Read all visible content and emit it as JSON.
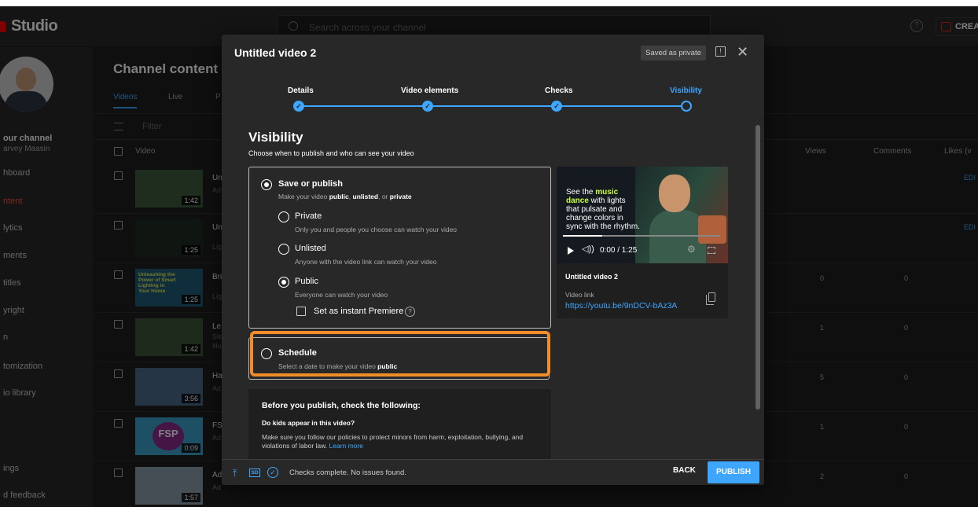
{
  "app": {
    "logo": "Studio"
  },
  "header": {
    "search_placeholder": "Search across your channel",
    "create_label": "CREAT"
  },
  "sidebar": {
    "channel_label": "our channel",
    "channel_name": "arvey Maasin",
    "items": [
      {
        "label": "hboard"
      },
      {
        "label": "ntent"
      },
      {
        "label": "lytics"
      },
      {
        "label": "ments"
      },
      {
        "label": "titles"
      },
      {
        "label": "yright"
      },
      {
        "label": "n"
      },
      {
        "label": "tomization"
      },
      {
        "label": "io library"
      },
      {
        "label": "ings"
      },
      {
        "label": "d feedback"
      }
    ]
  },
  "main": {
    "title": "Channel content",
    "tabs": [
      "Videos",
      "Live",
      "P"
    ],
    "filter": "Filter",
    "columns": {
      "video": "Video",
      "views": "Views",
      "comments": "Comments",
      "likes": "Likes (v"
    },
    "rows": [
      {
        "t": "Un",
        "s": "Ad",
        "dur": "1:42",
        "views": "",
        "comments": "",
        "edit": "EDI"
      },
      {
        "t": "Un",
        "s": "Lig",
        "dur": "1:25",
        "views": "",
        "comments": "",
        "edit": "EDI"
      },
      {
        "t": "Bri",
        "s": "Lig",
        "dur": "1:25",
        "views": "0",
        "comments": "0",
        "edit": "",
        "thumb_text": "Unleashing the Power of Smart Lighting in Your Home"
      },
      {
        "t": "Le",
        "s": "Ste",
        "s2": "Illu",
        "dur": "1:42",
        "views": "1",
        "comments": "0",
        "edit": ""
      },
      {
        "t": "Ha",
        "s": "Ad",
        "dur": "3:56",
        "views": "5",
        "comments": "0",
        "edit": ""
      },
      {
        "t": "FS",
        "s": "Ad",
        "dur": "0:09",
        "views": "1",
        "comments": "0",
        "edit": "",
        "thumb_text": "FSP"
      },
      {
        "t": "Ad",
        "s": "Ad",
        "dur": "1:57",
        "views": "2",
        "comments": "0",
        "edit": ""
      }
    ]
  },
  "dialog": {
    "title": "Untitled video 2",
    "saved_badge": "Saved as private",
    "steps": [
      {
        "label": "Details",
        "state": "done"
      },
      {
        "label": "Video elements",
        "state": "done"
      },
      {
        "label": "Checks",
        "state": "done"
      },
      {
        "label": "Visibility",
        "state": "current"
      }
    ],
    "visibility": {
      "heading": "Visibility",
      "subheading": "Choose when to publish and who can see your video",
      "save_title": "Save or publish",
      "save_desc_pre": "Make your video ",
      "save_desc_public": "public",
      "save_desc_sep1": ", ",
      "save_desc_unlisted": "unlisted",
      "save_desc_sep2": ", or ",
      "save_desc_private": "private",
      "private_label": "Private",
      "private_desc": "Only you and people you choose can watch your video",
      "unlisted_label": "Unlisted",
      "unlisted_desc": "Anyone with the video link can watch your video",
      "public_label": "Public",
      "public_desc": "Everyone can watch your video",
      "premiere_label": "Set as instant Premiere",
      "help_glyph": "?",
      "schedule_label": "Schedule",
      "schedule_desc_pre": "Select a date to make your video ",
      "schedule_desc_public": "public"
    },
    "before": {
      "heading": "Before you publish, check the following:",
      "question": "Do kids appear in this video?",
      "text": "Make sure you follow our policies to protect minors from harm, exploitation, bullying, and violations of labor law. ",
      "link": "Learn more"
    },
    "preview": {
      "overlay_1": "See the ",
      "overlay_music": "music",
      "overlay_dance": "dance",
      "overlay_2": " with lights that pulsate and change colors in sync with the rhythm.",
      "time": "0:00 / 1:25",
      "title": "Untitled video 2",
      "link_label": "Video link",
      "link": "https://youtu.be/9nDCV-bAz3A",
      "progress": 0.25
    },
    "footer": {
      "status": "Checks complete. No issues found.",
      "back": "BACK",
      "publish": "PUBLISH",
      "sd_badge": "SD"
    }
  },
  "colors": {
    "accent": "#3ea6ff",
    "highlight": "#f08c2a",
    "brand": "#ff0000"
  }
}
